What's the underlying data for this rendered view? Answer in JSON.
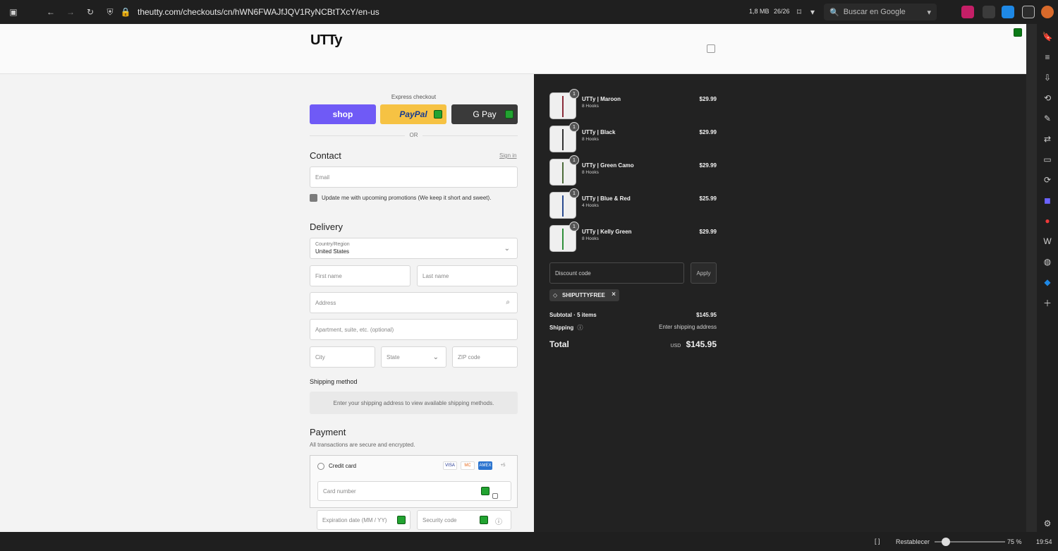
{
  "browser": {
    "url": "theutty.com/checkouts/cn/hWN6FWAJfJQV1RyNCBtTXcY/en-us",
    "memory": "1,8 MB",
    "tab_count": "26/26",
    "search_placeholder": "Buscar en Google",
    "zoom_reset": "Restablecer",
    "zoom_level": "75 %",
    "clock": "19:54"
  },
  "store": {
    "logo_text": "UTTy"
  },
  "express": {
    "label": "Express checkout",
    "shop_label": "shop",
    "paypal_label": "PayPal",
    "gpay_label": "G Pay",
    "or_label": "OR"
  },
  "contact": {
    "title": "Contact",
    "signin_label": "Sign in",
    "email_placeholder": "Email",
    "promo_label": "Update me with upcoming promotions (We keep it short and sweet)."
  },
  "delivery": {
    "title": "Delivery",
    "country_label": "Country/Region",
    "country_value": "United States",
    "first_name_placeholder": "First name",
    "last_name_placeholder": "Last name",
    "address_placeholder": "Address",
    "apartment_placeholder": "Apartment, suite, etc. (optional)",
    "city_placeholder": "City",
    "state_placeholder": "State",
    "zip_placeholder": "ZIP code"
  },
  "shipping": {
    "title": "Shipping method",
    "note": "Enter your shipping address to view available shipping methods."
  },
  "payment": {
    "title": "Payment",
    "subtitle": "All transactions are secure and encrypted.",
    "method_label": "Credit card",
    "card_brands": [
      "VISA",
      "MC",
      "AMEX",
      "+5"
    ],
    "card_number_placeholder": "Card number",
    "expiry_placeholder": "Expiration date (MM / YY)",
    "security_placeholder": "Security code"
  },
  "cart": {
    "items": [
      {
        "name": "UTTy | Maroon",
        "variant": "8 Hooks",
        "price": "$29.99",
        "qty": "1"
      },
      {
        "name": "UTTy | Black",
        "variant": "8 Hooks",
        "price": "$29.99",
        "qty": "1"
      },
      {
        "name": "UTTy | Green Camo",
        "variant": "8 Hooks",
        "price": "$29.99",
        "qty": "1"
      },
      {
        "name": "UTTy | Blue & Red",
        "variant": "4 Hooks",
        "price": "$25.99",
        "qty": "1"
      },
      {
        "name": "UTTy | Kelly Green",
        "variant": "8 Hooks",
        "price": "$29.99",
        "qty": "1"
      }
    ],
    "discount_placeholder": "Discount code",
    "apply_label": "Apply",
    "applied_code": "SHIPUTTYFREE",
    "subtotal_label": "Subtotal · 5 items",
    "subtotal_value": "$145.95",
    "shipping_label": "Shipping",
    "shipping_value": "Enter shipping address",
    "total_label": "Total",
    "total_currency": "USD",
    "total_value": "$145.95"
  }
}
